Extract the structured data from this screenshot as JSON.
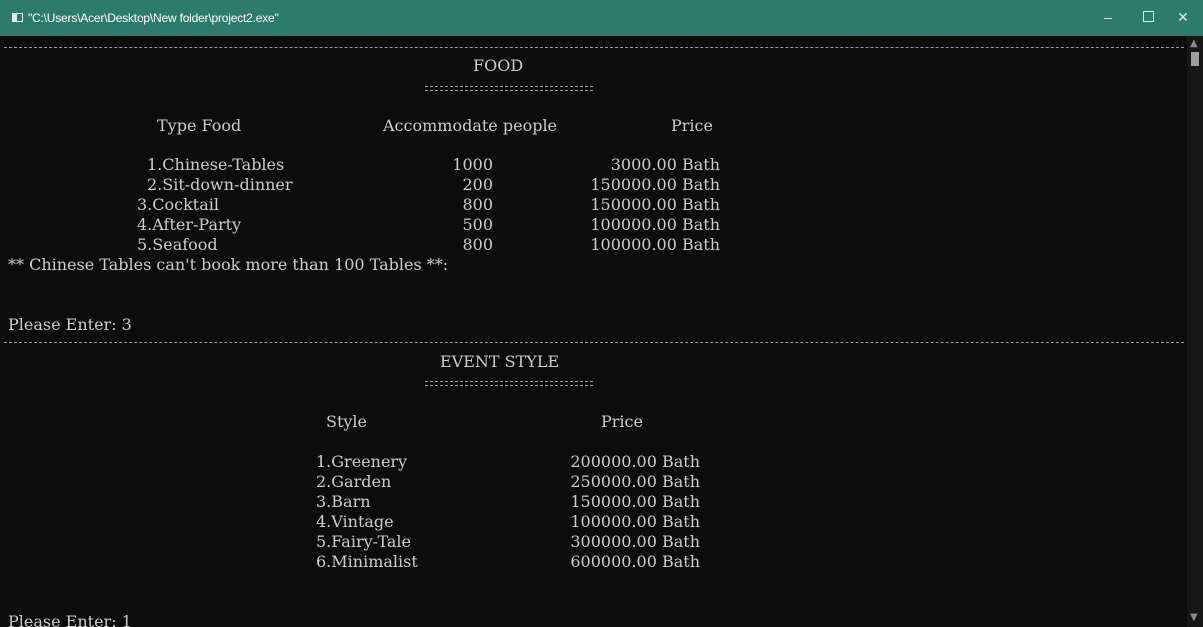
{
  "window": {
    "title": "\"C:\\Users\\Acer\\Desktop\\New folder\\project2.exe\"",
    "minimize_glyph": "–",
    "close_glyph": "✕",
    "icon": "console-window-icon"
  },
  "food": {
    "heading": "FOOD",
    "headers": {
      "type": "Type Food",
      "accommodate": "Accommodate people",
      "price": "Price"
    },
    "rows": [
      {
        "name": "1.Chinese-Tables",
        "people": "1000",
        "price": "3000.00 Bath"
      },
      {
        "name": "2.Sit-down-dinner",
        "people": "200",
        "price": "150000.00 Bath"
      },
      {
        "name": "3.Cocktail",
        "people": "800",
        "price": "150000.00 Bath"
      },
      {
        "name": "4.After-Party",
        "people": "500",
        "price": "100000.00 Bath"
      },
      {
        "name": "5.Seafood",
        "people": "800",
        "price": "100000.00 Bath"
      }
    ],
    "note": "** Chinese Tables can't book more than 100 Tables **:",
    "prompt": "Please Enter: 3"
  },
  "event": {
    "heading": "EVENT STYLE",
    "headers": {
      "style": "Style",
      "price": "Price"
    },
    "rows": [
      {
        "name": "1.Greenery",
        "price": "200000.00 Bath"
      },
      {
        "name": "2.Garden",
        "price": "250000.00 Bath"
      },
      {
        "name": "3.Barn",
        "price": "150000.00 Bath"
      },
      {
        "name": "4.Vintage",
        "price": "100000.00 Bath"
      },
      {
        "name": "5.Fairy-Tale",
        "price": "300000.00 Bath"
      },
      {
        "name": "6.Minimalist",
        "price": "600000.00 Bath"
      }
    ],
    "prompt": "Please Enter: 1"
  },
  "colors": {
    "titlebar": "#2e7b6e",
    "console_bg": "#0c0c0c",
    "console_text": "#cccccc"
  }
}
